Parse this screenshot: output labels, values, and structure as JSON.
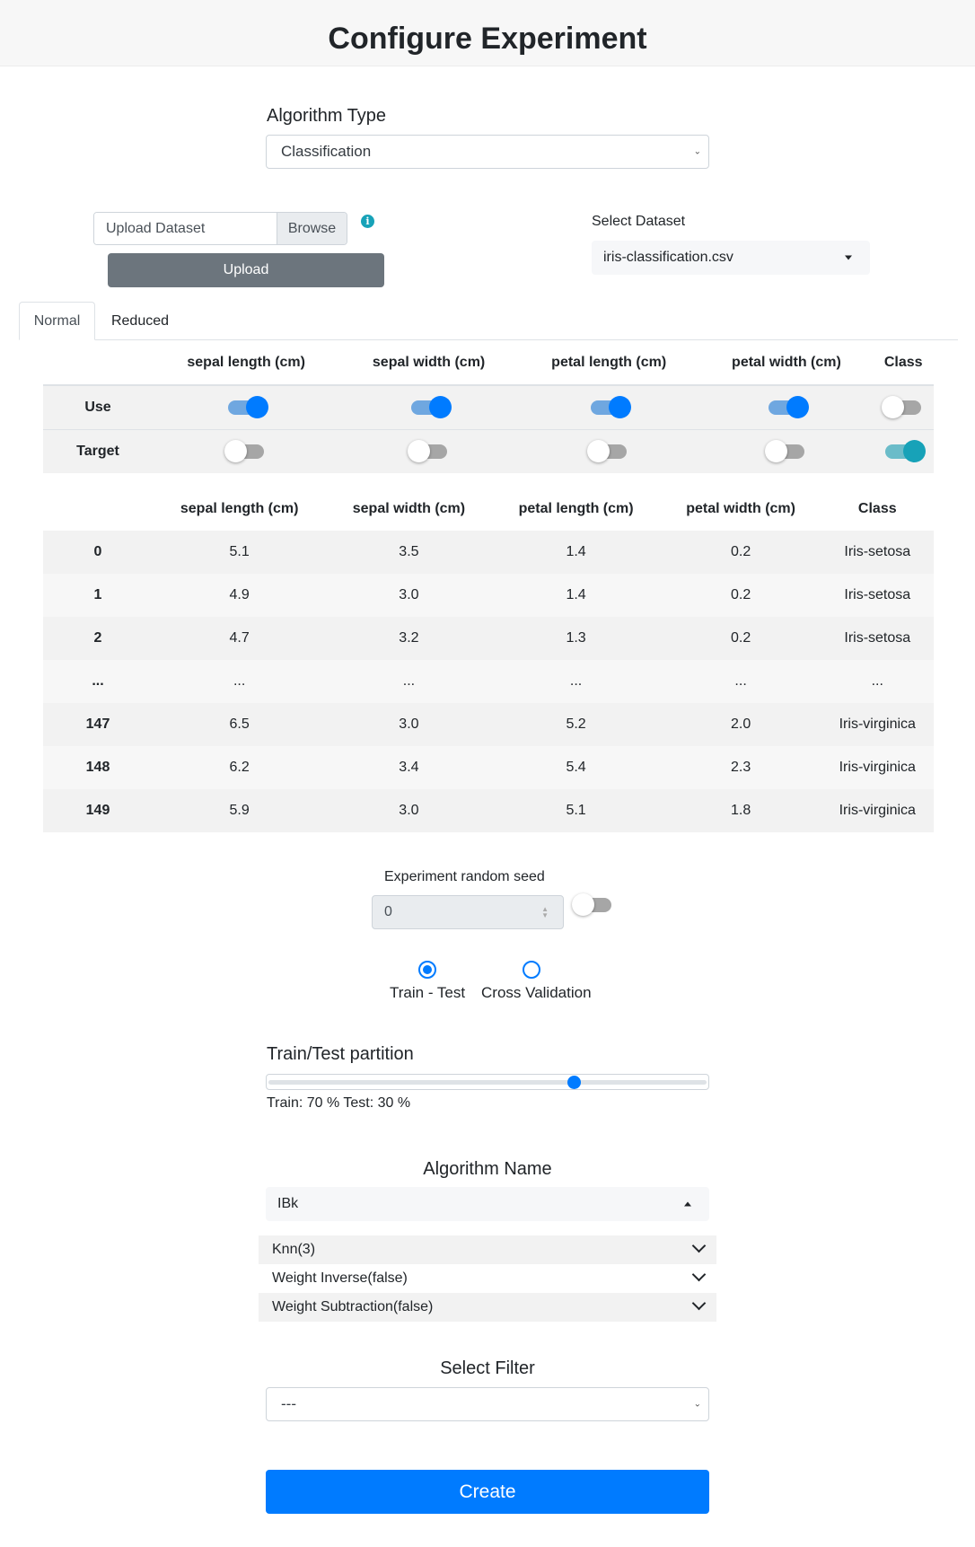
{
  "page": {
    "title": "Configure Experiment"
  },
  "algorithm_type": {
    "label": "Algorithm Type",
    "value": "Classification"
  },
  "upload": {
    "file_label": "Upload Dataset",
    "browse_label": "Browse",
    "button_label": "Upload",
    "info_icon": "info-icon"
  },
  "dataset": {
    "label": "Select Dataset",
    "value": "iris-classification.csv"
  },
  "tabs": [
    {
      "label": "Normal",
      "active": true
    },
    {
      "label": "Reduced",
      "active": false
    }
  ],
  "columns": [
    "sepal length (cm)",
    "sepal width (cm)",
    "petal length (cm)",
    "petal width (cm)",
    "Class"
  ],
  "config": {
    "use_label": "Use",
    "target_label": "Target",
    "use": [
      true,
      true,
      true,
      true,
      false
    ],
    "target": [
      false,
      false,
      false,
      false,
      true
    ]
  },
  "data_table": {
    "rows": [
      [
        "0",
        "5.1",
        "3.5",
        "1.4",
        "0.2",
        "Iris-setosa"
      ],
      [
        "1",
        "4.9",
        "3.0",
        "1.4",
        "0.2",
        "Iris-setosa"
      ],
      [
        "2",
        "4.7",
        "3.2",
        "1.3",
        "0.2",
        "Iris-setosa"
      ],
      [
        "...",
        "...",
        "...",
        "...",
        "...",
        "..."
      ],
      [
        "147",
        "6.5",
        "3.0",
        "5.2",
        "2.0",
        "Iris-virginica"
      ],
      [
        "148",
        "6.2",
        "3.4",
        "5.4",
        "2.3",
        "Iris-virginica"
      ],
      [
        "149",
        "5.9",
        "3.0",
        "5.1",
        "1.8",
        "Iris-virginica"
      ]
    ]
  },
  "seed": {
    "label": "Experiment random seed",
    "value": "0",
    "enabled": false
  },
  "validation": {
    "options": [
      "Train - Test",
      "Cross Validation"
    ],
    "selected": "Train - Test"
  },
  "partition": {
    "label": "Train/Test partition",
    "train_percent": 70,
    "text": "Train: 70 % Test: 30 %"
  },
  "algorithm": {
    "label": "Algorithm Name",
    "value": "IBk",
    "params": [
      "Knn(3)",
      "Weight Inverse(false)",
      "Weight Subtraction(false)"
    ]
  },
  "filter": {
    "label": "Select Filter",
    "value": "---"
  },
  "create_button": "Create",
  "colors": {
    "primary": "#007bff",
    "secondary": "#6c757d",
    "info": "#17a2b8"
  }
}
